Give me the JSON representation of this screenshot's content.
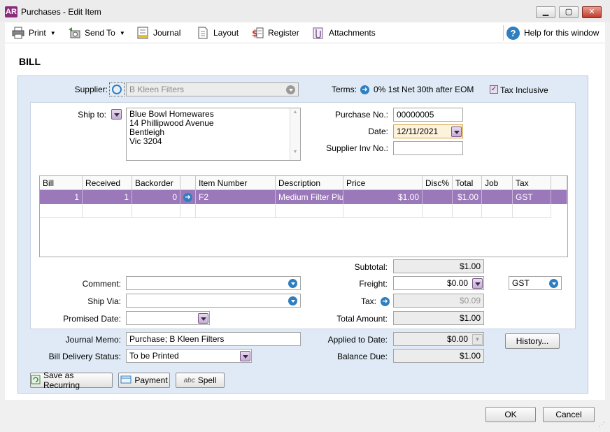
{
  "window": {
    "app_badge": "AR",
    "title": "Purchases - Edit Item",
    "minimize_glyph": "▁",
    "maximize_glyph": "▢",
    "close_glyph": "✕"
  },
  "toolbar": {
    "print_label": "Print",
    "sendto_label": "Send To",
    "journal_label": "Journal",
    "layout_label": "Layout",
    "register_label": "Register",
    "attachments_label": "Attachments",
    "help_label": "Help for this window"
  },
  "form": {
    "section_title": "BILL",
    "supplier_label": "Supplier:",
    "supplier_value": "B Kleen Filters",
    "terms_label": "Terms:",
    "terms_value": "0% 1st Net 30th after EOM",
    "tax_inclusive_label": "Tax Inclusive",
    "tax_inclusive_checked": true,
    "ship_to_label": "Ship to:",
    "ship_to_lines": [
      "Blue Bowl Homewares",
      "14 Phillipwood Avenue",
      "Bentleigh",
      "Vic 3204"
    ],
    "purchase_no_label": "Purchase No.:",
    "purchase_no_value": "00000005",
    "date_label": "Date:",
    "date_value": "12/11/2021",
    "supplier_inv_label": "Supplier Inv No.:",
    "supplier_inv_value": ""
  },
  "grid": {
    "columns": [
      "Bill",
      "Received",
      "Backorder",
      "",
      "Item Number",
      "Description",
      "Price",
      "Disc%",
      "Total",
      "Job",
      "Tax"
    ],
    "rows": [
      {
        "bill": "1",
        "received": "1",
        "backorder": "0",
        "item_number": "F2",
        "description": "Medium Filter Plug",
        "price": "$1.00",
        "disc": "",
        "total": "$1.00",
        "job": "",
        "tax": "GST"
      }
    ]
  },
  "bottom": {
    "comment_label": "Comment:",
    "comment_value": "",
    "ship_via_label": "Ship Via:",
    "ship_via_value": "",
    "promised_date_label": "Promised Date:",
    "promised_date_value": "",
    "subtotal_label": "Subtotal:",
    "subtotal_value": "$1.00",
    "freight_label": "Freight:",
    "freight_value": "$0.00",
    "freight_tax_code": "GST",
    "tax_label": "Tax:",
    "tax_value": "$0.09",
    "total_amount_label": "Total Amount:",
    "total_amount_value": "$1.00",
    "journal_memo_label": "Journal Memo:",
    "journal_memo_value": "Purchase; B Kleen Filters",
    "applied_label": "Applied to Date:",
    "applied_value": "$0.00",
    "history_label": "History...",
    "delivery_label": "Bill Delivery Status:",
    "delivery_value": "To be Printed",
    "balance_label": "Balance Due:",
    "balance_value": "$1.00"
  },
  "actions": {
    "save_recurring_label": "Save as Recurring",
    "payment_label": "Payment",
    "spell_label": "Spell",
    "ok_label": "OK",
    "cancel_label": "Cancel"
  },
  "colors": {
    "accent_purple": "#9a78ba",
    "panel_blue": "#dfeaf6",
    "help_blue": "#2f7ec0"
  }
}
